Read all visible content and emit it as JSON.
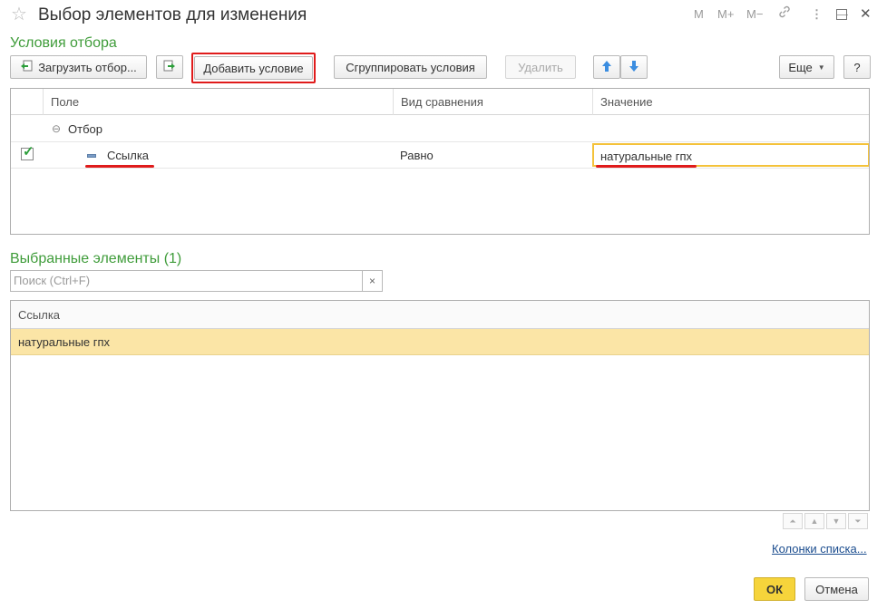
{
  "window": {
    "title": "Выбор элементов для изменения",
    "star_glyph": "☆",
    "controls": [
      "M",
      "M+",
      "M−",
      "⋮",
      "—",
      "☐",
      "✕"
    ]
  },
  "conditions": {
    "section_title": "Условия отбора",
    "toolbar": {
      "load_filter": "Загрузить отбор...",
      "add_condition": "Добавить условие",
      "group_conditions": "Сгруппировать условия",
      "delete": "Удалить",
      "more": "Еще",
      "help": "?"
    },
    "columns": [
      "Поле",
      "Вид сравнения",
      "Значение"
    ],
    "group_row": {
      "label": "Отбор",
      "collapse_glyph": "⊖"
    },
    "rows": [
      {
        "checked": true,
        "field": "Ссылка",
        "comparison": "Равно",
        "value": "натуральные гпх"
      }
    ]
  },
  "selected": {
    "section_title": "Выбранные элементы (1)",
    "search": {
      "placeholder": "Поиск (Ctrl+F)",
      "clear_glyph": "×"
    },
    "columns": [
      "Ссылка"
    ],
    "rows": [
      {
        "ref": "натуральные гпх"
      }
    ],
    "nav": [
      "⏶",
      "▲",
      "▼",
      "⏷"
    ],
    "columns_link": "Колонки списка..."
  },
  "footer": {
    "ok": "ОК",
    "cancel": "Отмена"
  },
  "colors": {
    "accent_green": "#3f9c3a",
    "highlight_red": "#e01b1b",
    "selected_row": "#fbe5a6",
    "focus_yellow": "#f4c23a",
    "ok_yellow": "#f6d43b",
    "arrow_blue": "#3b8de0"
  }
}
